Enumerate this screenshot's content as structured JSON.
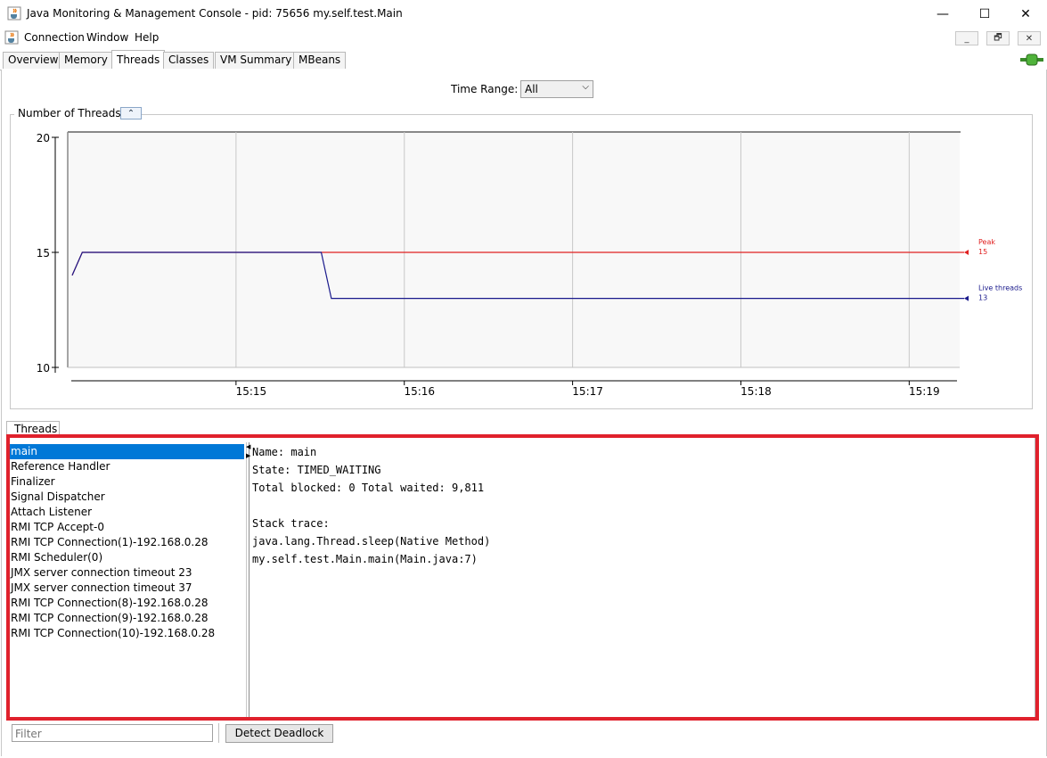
{
  "window": {
    "title": "Java Monitoring & Management Console - pid: 75656 my.self.test.Main",
    "minimize": "—",
    "maximize": "☐",
    "close": "✕"
  },
  "menu": {
    "items": [
      "Connection",
      "Window",
      "Help"
    ],
    "mdi": [
      "_",
      "🗗",
      "✕"
    ]
  },
  "tabs": [
    {
      "label": "Overview",
      "active": false
    },
    {
      "label": "Memory",
      "active": false
    },
    {
      "label": "Threads",
      "active": true
    },
    {
      "label": "Classes",
      "active": false
    },
    {
      "label": "VM Summary",
      "active": false
    },
    {
      "label": "MBeans",
      "active": false
    }
  ],
  "time_range": {
    "label": "Time Range:",
    "value": "All"
  },
  "chart_data": {
    "type": "line",
    "title": "Number of Threads",
    "ylim": [
      10,
      20
    ],
    "yticks": [
      10,
      15,
      20
    ],
    "xticks": [
      {
        "label": "15:15",
        "minute": 15.0
      },
      {
        "label": "15:16",
        "minute": 16.0
      },
      {
        "label": "15:17",
        "minute": 17.0
      },
      {
        "label": "15:18",
        "minute": 18.0
      },
      {
        "label": "15:19",
        "minute": 19.0
      }
    ],
    "xlim": [
      14.0,
      19.3
    ],
    "grid": true,
    "series": [
      {
        "name": "Peak",
        "color": "#e02020",
        "points": [
          [
            14.0,
            14.0
          ],
          [
            14.06,
            15
          ],
          [
            15.48,
            15
          ],
          [
            19.3,
            15
          ]
        ]
      },
      {
        "name": "Live threads",
        "color": "#1a1a8c",
        "points": [
          [
            14.0,
            14.0
          ],
          [
            14.06,
            15
          ],
          [
            15.48,
            15
          ],
          [
            15.54,
            13
          ],
          [
            19.3,
            13
          ]
        ]
      }
    ],
    "legend": [
      {
        "name": "Peak",
        "value": "15",
        "color": "#e02020"
      },
      {
        "name": "Live threads",
        "value": "13",
        "color": "#1a1a8c"
      }
    ]
  },
  "threads_panel": {
    "tab_label": "Threads",
    "items": [
      "main",
      "Reference Handler",
      "Finalizer",
      "Signal Dispatcher",
      "Attach Listener",
      "RMI TCP Accept-0",
      "RMI TCP Connection(1)-192.168.0.28",
      "RMI Scheduler(0)",
      "JMX server connection timeout 23",
      "JMX server connection timeout 37",
      "RMI TCP Connection(8)-192.168.0.28",
      "RMI TCP Connection(9)-192.168.0.28",
      "RMI TCP Connection(10)-192.168.0.28"
    ],
    "selected_index": 0,
    "detail": {
      "name": "Name: main",
      "state": "State: TIMED_WAITING",
      "totals": "Total blocked: 0  Total waited: 9,811",
      "stack_label": "Stack trace:",
      "stack": [
        "java.lang.Thread.sleep(Native Method)",
        "my.self.test.Main.main(Main.java:7)"
      ]
    },
    "filter_placeholder": "Filter",
    "detect_button": "Detect Deadlock"
  },
  "colors": {
    "selection": "#0078d7",
    "highlight": "#e0212c"
  }
}
